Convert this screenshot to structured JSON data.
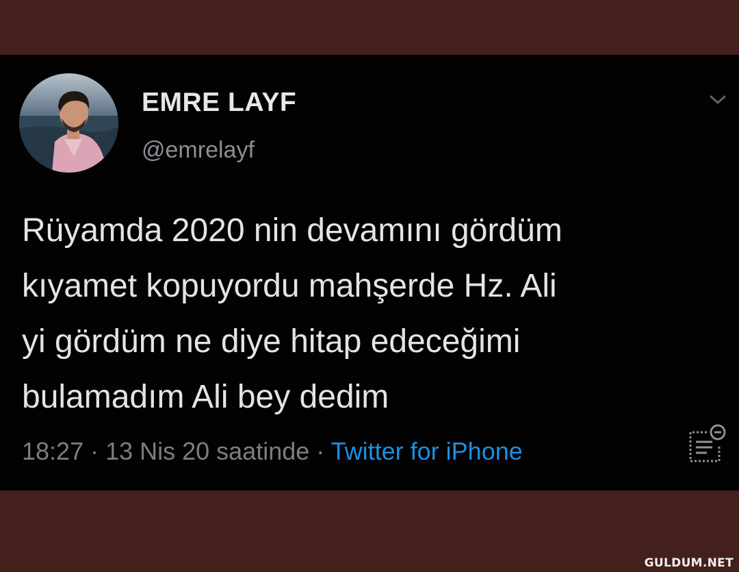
{
  "tweet": {
    "display_name": "EMRE LAYF",
    "username": "@emrelayf",
    "text": "Rüyamda 2020 nin devamını gördüm\nkıyamet kopuyordu mahşerde Hz. Ali\nyi gördüm ne diye hitap edeceğimi\nbulamadım Ali bey dedim",
    "time": "18:27",
    "separator": " · ",
    "date": "13 Nis 20 saatinde",
    "source": "Twitter for iPhone",
    "menu_icon": "chevron-down-icon",
    "analytics_icon": "tweet-analytics-icon"
  },
  "watermark": "GULDUM.NET",
  "colors": {
    "page_background": "#43201c",
    "card_background": "#020202",
    "text": "#e4e4e4",
    "muted": "#7b7f84",
    "link": "#1d8fe0"
  }
}
